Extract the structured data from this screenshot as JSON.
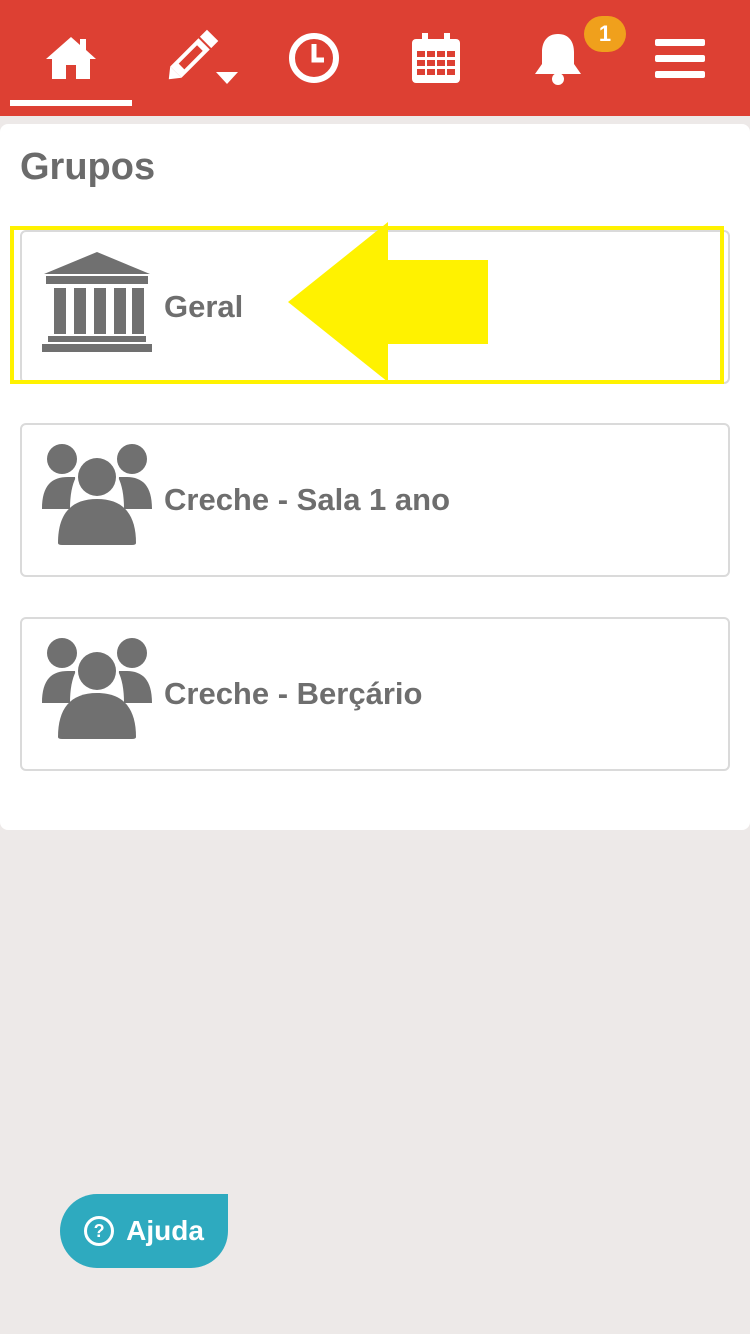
{
  "colors": {
    "topbar": "#dd4033",
    "badge": "#f0a01c",
    "highlight": "#fff200",
    "help": "#2eaabf",
    "background": "#ede9e8"
  },
  "nav": {
    "items": [
      {
        "icon": "home-icon",
        "active": true
      },
      {
        "icon": "pencil-icon"
      },
      {
        "icon": "clock-icon"
      },
      {
        "icon": "calendar-icon"
      },
      {
        "icon": "bell-icon"
      },
      {
        "icon": "menu-icon"
      }
    ],
    "notification_count": "1"
  },
  "panel": {
    "title": "Grupos"
  },
  "groups": [
    {
      "label": "Geral",
      "icon": "institution-icon"
    },
    {
      "label": "Creche - Sala 1 ano",
      "icon": "users-icon"
    },
    {
      "label": "Creche - Berçário",
      "icon": "users-icon"
    }
  ],
  "help": {
    "label": "Ajuda",
    "icon_glyph": "?"
  }
}
